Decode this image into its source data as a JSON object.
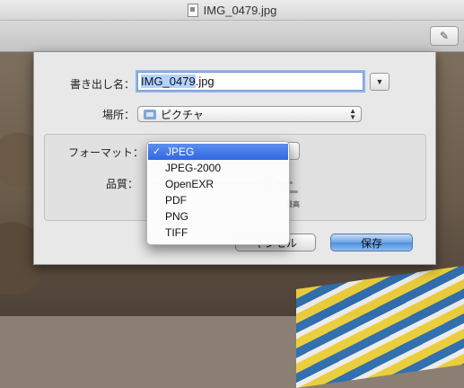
{
  "window": {
    "title": "IMG_0479.jpg"
  },
  "toolbar": {
    "edit_icon": "pencil-icon"
  },
  "dialog": {
    "filename_label": "書き出し名：",
    "filename_value_selected": "IMG_0479",
    "filename_value_ext": ".jpg",
    "location_label": "場所：",
    "location_value": "ピクチャ",
    "format_label": "フォーマット：",
    "quality_label": "品質：",
    "quality_max_label": "最高",
    "cancel_label": "キャンセル",
    "cancel_visible_fragment": "ャンセル",
    "save_label": "保存"
  },
  "format_menu": {
    "items": [
      "JPEG",
      "JPEG-2000",
      "OpenEXR",
      "PDF",
      "PNG",
      "TIFF"
    ],
    "selected": "JPEG",
    "check_mark": "✓"
  },
  "colors": {
    "accent": "#2f67e2",
    "focus_ring": "#8fb4ea",
    "primary_button": "#4f8fdf"
  }
}
